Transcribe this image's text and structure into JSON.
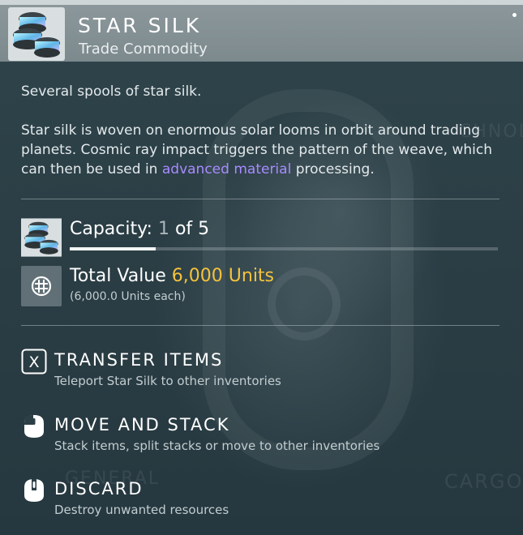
{
  "item": {
    "name": "STAR SILK",
    "category": "Trade Commodity",
    "icon": "star-silk-spools-icon"
  },
  "description": {
    "short": "Several spools of star silk.",
    "long_before": "Star silk is woven on enormous solar looms in orbit around trading planets. Cosmic ray impact triggers the pattern of the weave, which can then be used in ",
    "long_highlight": "advanced material",
    "long_after": " processing.",
    "highlight_color": "#a88bff"
  },
  "capacity": {
    "label": "Capacity:",
    "current": "1",
    "of_text": "of 5",
    "fill_fraction": 0.2
  },
  "value": {
    "label": "Total Value",
    "amount": "6,000 Units",
    "each": "(6,000.0 Units each)",
    "icon": "units-currency-icon",
    "amount_color": "#f5c33b"
  },
  "actions": [
    {
      "title": "TRANSFER ITEMS",
      "subtitle": "Teleport Star Silk to other inventories",
      "icon": "x-key-icon"
    },
    {
      "title": "MOVE AND STACK",
      "subtitle": "Stack items, split stacks or move to other inventories",
      "icon": "mouse-left-click-icon"
    },
    {
      "title": "DISCARD",
      "subtitle": "Destroy unwanted resources",
      "icon": "mouse-middle-click-icon"
    }
  ],
  "background_text": [
    "CHNOLO",
    "CARGO",
    "GENERAL"
  ]
}
